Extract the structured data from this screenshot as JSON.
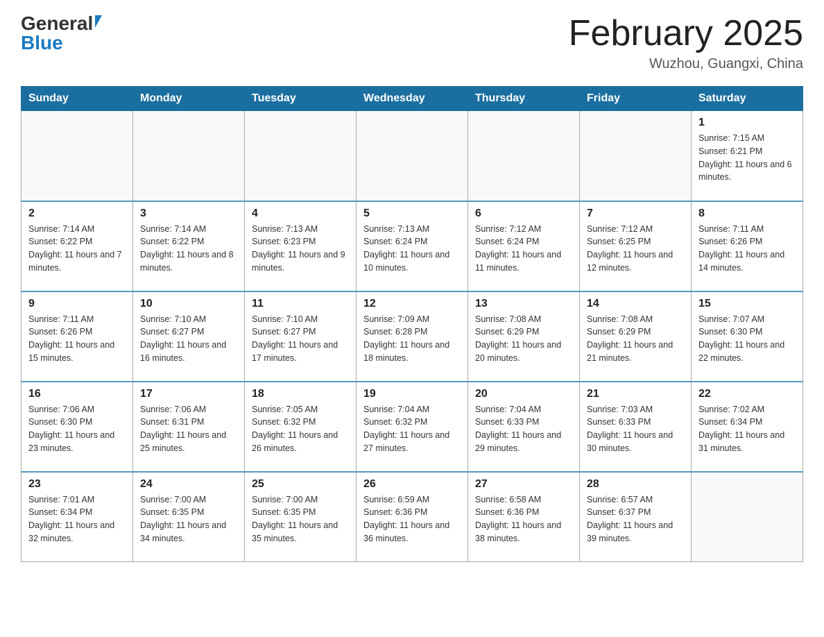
{
  "header": {
    "logo_general": "General",
    "logo_blue": "Blue",
    "month_title": "February 2025",
    "location": "Wuzhou, Guangxi, China"
  },
  "weekdays": [
    "Sunday",
    "Monday",
    "Tuesday",
    "Wednesday",
    "Thursday",
    "Friday",
    "Saturday"
  ],
  "weeks": [
    [
      {
        "day": "",
        "info": ""
      },
      {
        "day": "",
        "info": ""
      },
      {
        "day": "",
        "info": ""
      },
      {
        "day": "",
        "info": ""
      },
      {
        "day": "",
        "info": ""
      },
      {
        "day": "",
        "info": ""
      },
      {
        "day": "1",
        "info": "Sunrise: 7:15 AM\nSunset: 6:21 PM\nDaylight: 11 hours and 6 minutes."
      }
    ],
    [
      {
        "day": "2",
        "info": "Sunrise: 7:14 AM\nSunset: 6:22 PM\nDaylight: 11 hours and 7 minutes."
      },
      {
        "day": "3",
        "info": "Sunrise: 7:14 AM\nSunset: 6:22 PM\nDaylight: 11 hours and 8 minutes."
      },
      {
        "day": "4",
        "info": "Sunrise: 7:13 AM\nSunset: 6:23 PM\nDaylight: 11 hours and 9 minutes."
      },
      {
        "day": "5",
        "info": "Sunrise: 7:13 AM\nSunset: 6:24 PM\nDaylight: 11 hours and 10 minutes."
      },
      {
        "day": "6",
        "info": "Sunrise: 7:12 AM\nSunset: 6:24 PM\nDaylight: 11 hours and 11 minutes."
      },
      {
        "day": "7",
        "info": "Sunrise: 7:12 AM\nSunset: 6:25 PM\nDaylight: 11 hours and 12 minutes."
      },
      {
        "day": "8",
        "info": "Sunrise: 7:11 AM\nSunset: 6:26 PM\nDaylight: 11 hours and 14 minutes."
      }
    ],
    [
      {
        "day": "9",
        "info": "Sunrise: 7:11 AM\nSunset: 6:26 PM\nDaylight: 11 hours and 15 minutes."
      },
      {
        "day": "10",
        "info": "Sunrise: 7:10 AM\nSunset: 6:27 PM\nDaylight: 11 hours and 16 minutes."
      },
      {
        "day": "11",
        "info": "Sunrise: 7:10 AM\nSunset: 6:27 PM\nDaylight: 11 hours and 17 minutes."
      },
      {
        "day": "12",
        "info": "Sunrise: 7:09 AM\nSunset: 6:28 PM\nDaylight: 11 hours and 18 minutes."
      },
      {
        "day": "13",
        "info": "Sunrise: 7:08 AM\nSunset: 6:29 PM\nDaylight: 11 hours and 20 minutes."
      },
      {
        "day": "14",
        "info": "Sunrise: 7:08 AM\nSunset: 6:29 PM\nDaylight: 11 hours and 21 minutes."
      },
      {
        "day": "15",
        "info": "Sunrise: 7:07 AM\nSunset: 6:30 PM\nDaylight: 11 hours and 22 minutes."
      }
    ],
    [
      {
        "day": "16",
        "info": "Sunrise: 7:06 AM\nSunset: 6:30 PM\nDaylight: 11 hours and 23 minutes."
      },
      {
        "day": "17",
        "info": "Sunrise: 7:06 AM\nSunset: 6:31 PM\nDaylight: 11 hours and 25 minutes."
      },
      {
        "day": "18",
        "info": "Sunrise: 7:05 AM\nSunset: 6:32 PM\nDaylight: 11 hours and 26 minutes."
      },
      {
        "day": "19",
        "info": "Sunrise: 7:04 AM\nSunset: 6:32 PM\nDaylight: 11 hours and 27 minutes."
      },
      {
        "day": "20",
        "info": "Sunrise: 7:04 AM\nSunset: 6:33 PM\nDaylight: 11 hours and 29 minutes."
      },
      {
        "day": "21",
        "info": "Sunrise: 7:03 AM\nSunset: 6:33 PM\nDaylight: 11 hours and 30 minutes."
      },
      {
        "day": "22",
        "info": "Sunrise: 7:02 AM\nSunset: 6:34 PM\nDaylight: 11 hours and 31 minutes."
      }
    ],
    [
      {
        "day": "23",
        "info": "Sunrise: 7:01 AM\nSunset: 6:34 PM\nDaylight: 11 hours and 32 minutes."
      },
      {
        "day": "24",
        "info": "Sunrise: 7:00 AM\nSunset: 6:35 PM\nDaylight: 11 hours and 34 minutes."
      },
      {
        "day": "25",
        "info": "Sunrise: 7:00 AM\nSunset: 6:35 PM\nDaylight: 11 hours and 35 minutes."
      },
      {
        "day": "26",
        "info": "Sunrise: 6:59 AM\nSunset: 6:36 PM\nDaylight: 11 hours and 36 minutes."
      },
      {
        "day": "27",
        "info": "Sunrise: 6:58 AM\nSunset: 6:36 PM\nDaylight: 11 hours and 38 minutes."
      },
      {
        "day": "28",
        "info": "Sunrise: 6:57 AM\nSunset: 6:37 PM\nDaylight: 11 hours and 39 minutes."
      },
      {
        "day": "",
        "info": ""
      }
    ]
  ]
}
